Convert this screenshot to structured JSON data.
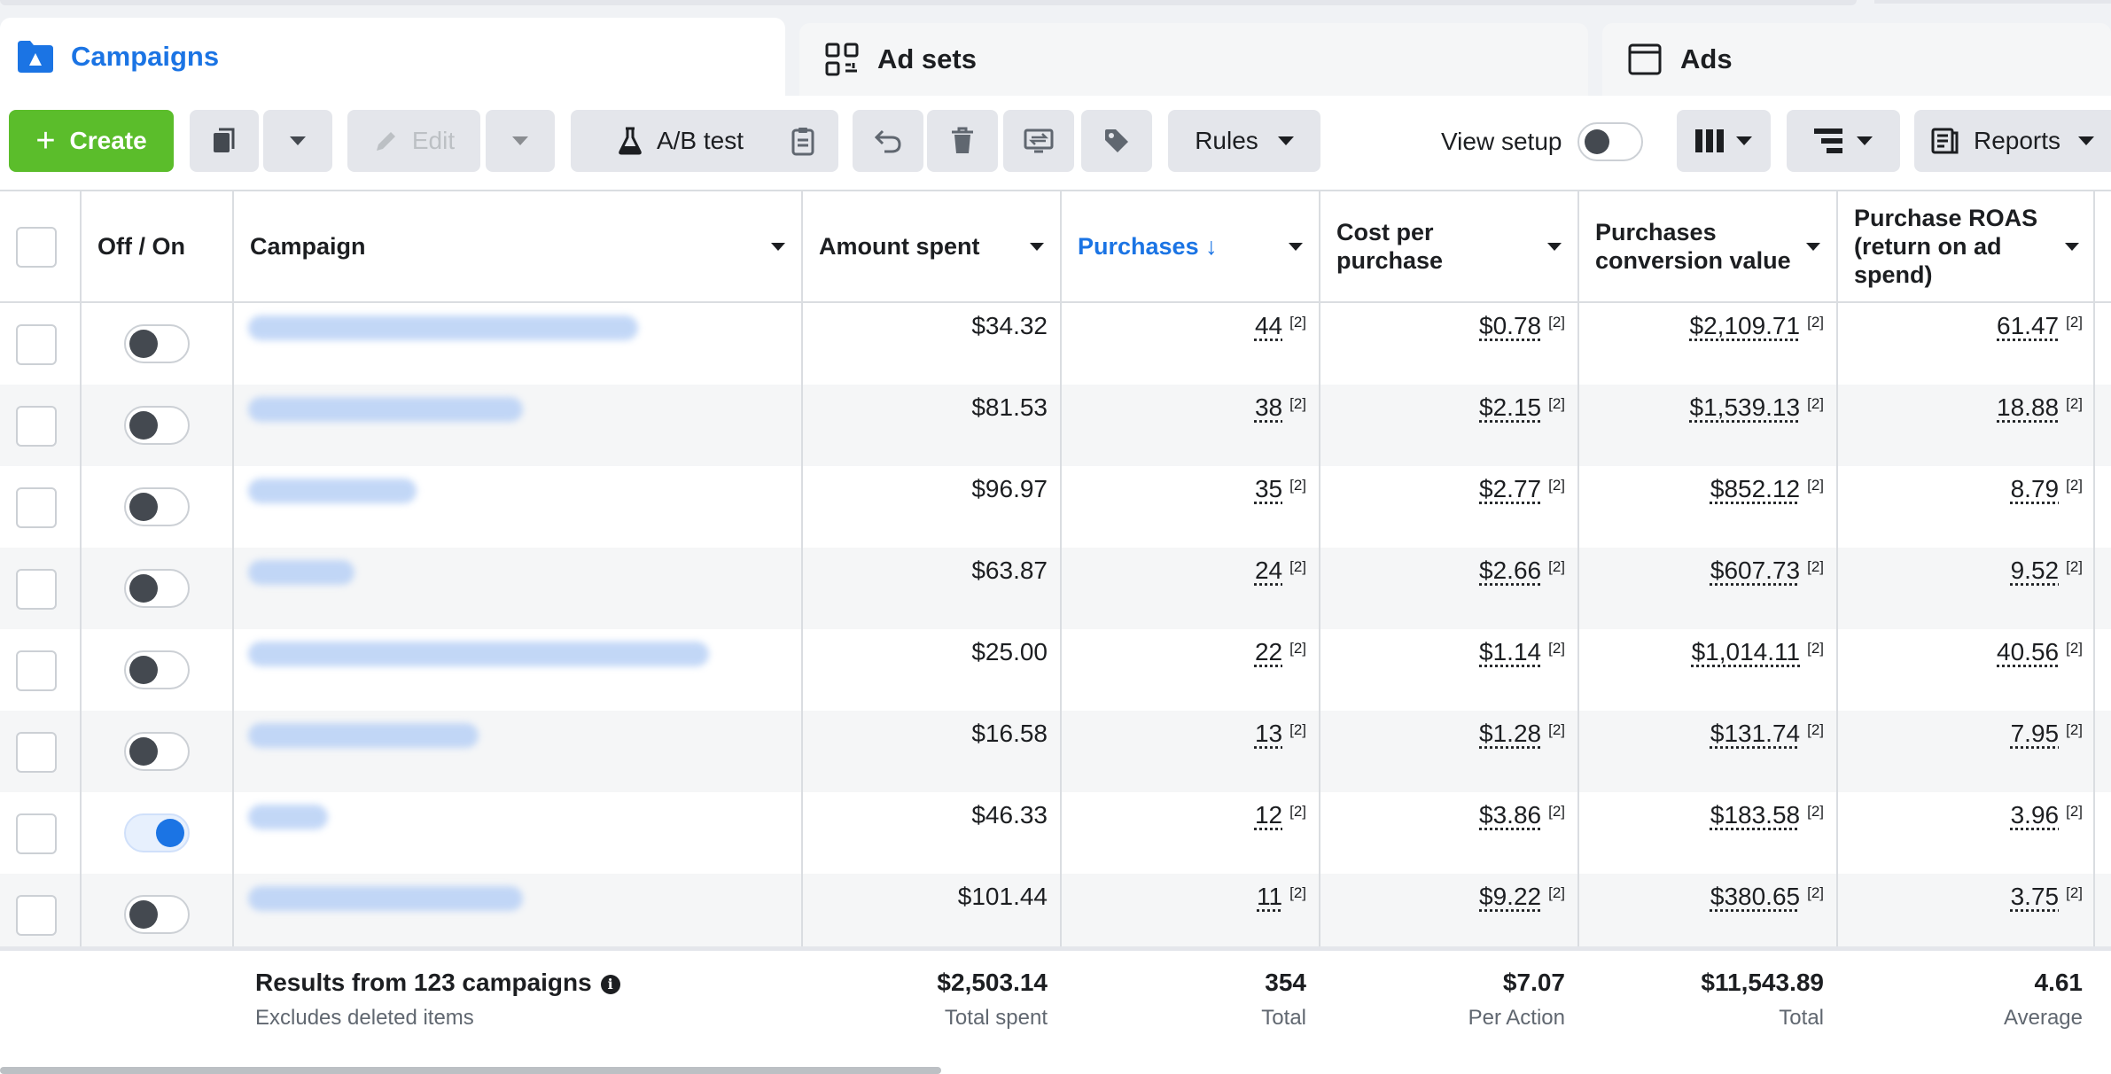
{
  "tabs": [
    {
      "label": "Campaigns",
      "icon": "folder-icon",
      "active": true
    },
    {
      "label": "Ad sets",
      "icon": "grid-icon",
      "active": false
    },
    {
      "label": "Ads",
      "icon": "ad-window-icon",
      "active": false
    }
  ],
  "toolbar": {
    "create_label": "Create",
    "edit_label": "Edit",
    "ab_test_label": "A/B test",
    "rules_label": "Rules",
    "view_setup_label": "View setup",
    "reports_label": "Reports"
  },
  "table": {
    "headers": {
      "off_on": "Off / On",
      "campaign": "Campaign",
      "amount_spent": "Amount spent",
      "purchases": "Purchases ↓",
      "cost_per_purchase_1": "Cost per",
      "cost_per_purchase_2": "purchase",
      "conv_value_1": "Purchases",
      "conv_value_2": "conversion value",
      "roas_1": "Purchase ROAS",
      "roas_2": "(return on ad",
      "roas_3": "spend)"
    },
    "footnote": "[2]",
    "rows": [
      {
        "on": false,
        "amount": "$34.32",
        "purchases": "44",
        "cpp": "$0.78",
        "value": "$2,109.71",
        "roas": "61.47"
      },
      {
        "on": false,
        "amount": "$81.53",
        "purchases": "38",
        "cpp": "$2.15",
        "value": "$1,539.13",
        "roas": "18.88"
      },
      {
        "on": false,
        "amount": "$96.97",
        "purchases": "35",
        "cpp": "$2.77",
        "value": "$852.12",
        "roas": "8.79"
      },
      {
        "on": false,
        "amount": "$63.87",
        "purchases": "24",
        "cpp": "$2.66",
        "value": "$607.73",
        "roas": "9.52"
      },
      {
        "on": false,
        "amount": "$25.00",
        "purchases": "22",
        "cpp": "$1.14",
        "value": "$1,014.11",
        "roas": "40.56"
      },
      {
        "on": false,
        "amount": "$16.58",
        "purchases": "13",
        "cpp": "$1.28",
        "value": "$131.74",
        "roas": "7.95"
      },
      {
        "on": true,
        "amount": "$46.33",
        "purchases": "12",
        "cpp": "$3.86",
        "value": "$183.58",
        "roas": "3.96"
      },
      {
        "on": false,
        "amount": "$101.44",
        "purchases": "11",
        "cpp": "$9.22",
        "value": "$380.65",
        "roas": "3.75"
      }
    ],
    "footer": {
      "results": "Results from 123 campaigns",
      "excludes": "Excludes deleted items",
      "amount": "$2,503.14",
      "amount_sub": "Total spent",
      "purchases": "354",
      "purchases_sub": "Total",
      "cpp": "$7.07",
      "cpp_sub": "Per Action",
      "value": "$11,543.89",
      "value_sub": "Total",
      "roas": "4.61",
      "roas_sub": "Average"
    }
  },
  "colors": {
    "accent": "#1b74e4",
    "create_green": "#5bbd2b"
  }
}
